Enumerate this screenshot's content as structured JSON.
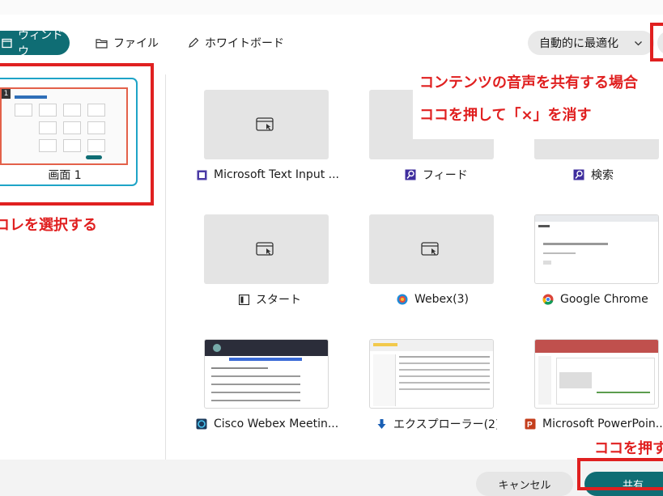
{
  "tabs": [
    {
      "label": "ウィンドウ",
      "icon": "window-icon",
      "active": true
    },
    {
      "label": "ファイル",
      "icon": "folder-icon"
    },
    {
      "label": "ホワイトボード",
      "icon": "pencil-icon"
    }
  ],
  "optimize": {
    "label": "自動的に最適化"
  },
  "screen": {
    "label": "画面 1",
    "number": "1"
  },
  "windows": [
    {
      "label": "Microsoft Text Input ...",
      "icon": "text-input-app-icon",
      "thumb": "placeholder"
    },
    {
      "label": "フィード",
      "icon": "search-app-icon",
      "thumb": "placeholder"
    },
    {
      "label": "検索",
      "icon": "search-app-icon",
      "thumb": "placeholder"
    },
    {
      "label": "スタート",
      "icon": "start-app-icon",
      "thumb": "placeholder"
    },
    {
      "label": "Webex(3)",
      "icon": "webex-icon",
      "thumb": "placeholder"
    },
    {
      "label": "Google Chrome",
      "icon": "chrome-icon",
      "thumb": "screenshot"
    },
    {
      "label": "Cisco Webex Meetin...",
      "icon": "cisco-webex-icon",
      "thumb": "screenshot"
    },
    {
      "label": "エクスプローラー(2)",
      "icon": "explorer-icon",
      "thumb": "screenshot"
    },
    {
      "label": "Microsoft PowerPoin...",
      "icon": "powerpoint-icon",
      "thumb": "screenshot"
    }
  ],
  "annotations": {
    "select_this": "コレを選択する",
    "audio_note_line1": "コンテンツの音声を共有する場合",
    "audio_note_line2": "ココを押して「×」を消す",
    "press_here": "ココを押す"
  },
  "footer": {
    "cancel_label": "キャンセル",
    "share_label": "共有"
  },
  "colors": {
    "accent": "#0f6d74",
    "selection": "#1ea4c7",
    "annotation_red": "#e02020"
  }
}
